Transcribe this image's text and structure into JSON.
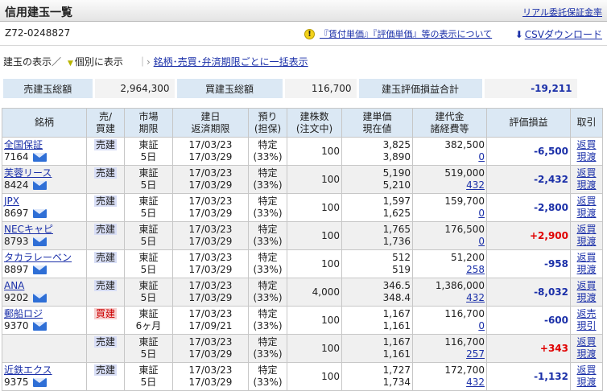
{
  "header": {
    "title": "信用建玉一覧",
    "right_link": "リアル委託保証金率"
  },
  "account": {
    "id": "Z72-0248827"
  },
  "hint": {
    "text": "『賃付単価』『評価単価』等の表示について"
  },
  "csv": {
    "label": "CSVダウンロード"
  },
  "view": {
    "item1": "建玉の表示／",
    "item2": "個別に表示",
    "sep": "｜",
    "item3": "銘柄･売買･弁済期限ごとに一括表示"
  },
  "summary": {
    "sell_label": "売建玉総額",
    "sell_value": "2,964,300",
    "buy_label": "買建玉総額",
    "buy_value": "116,700",
    "pl_label": "建玉評価損益合計",
    "pl_value": "-19,211"
  },
  "columns": {
    "name": "銘柄",
    "side_1": "売/",
    "side_2": "買建",
    "market_1": "市場",
    "market_2": "期限",
    "date_1": "建日",
    "date_2": "返済期限",
    "deposit_1": "預り",
    "deposit_2": "(担保)",
    "qty_1": "建株数",
    "qty_2": "(注文中)",
    "price_1": "建単価",
    "price_2": "現在値",
    "cost_1": "建代金",
    "cost_2": "諸経費等",
    "pl": "評価損益",
    "action": "取引"
  },
  "rows": [
    {
      "name": "全国保証",
      "code": "7164",
      "side": "売建",
      "market": "東証",
      "term": "5日",
      "open_date": "17/03/23",
      "due_date": "17/03/29",
      "deposit_1": "特定",
      "deposit_2": "(33%)",
      "qty": "100",
      "open_price": "3,825",
      "cur_price": "3,890",
      "cost": "382,500",
      "fees": "0",
      "pl": "-6,500",
      "action_1": "返買",
      "action_2": "現渡"
    },
    {
      "name": "芙蓉リース",
      "code": "8424",
      "side": "売建",
      "market": "東証",
      "term": "5日",
      "open_date": "17/03/23",
      "due_date": "17/03/29",
      "deposit_1": "特定",
      "deposit_2": "(33%)",
      "qty": "100",
      "open_price": "5,190",
      "cur_price": "5,210",
      "cost": "519,000",
      "fees": "432",
      "pl": "-2,432",
      "action_1": "返買",
      "action_2": "現渡"
    },
    {
      "name": "JPX",
      "code": "8697",
      "side": "売建",
      "market": "東証",
      "term": "5日",
      "open_date": "17/03/23",
      "due_date": "17/03/29",
      "deposit_1": "特定",
      "deposit_2": "(33%)",
      "qty": "100",
      "open_price": "1,597",
      "cur_price": "1,625",
      "cost": "159,700",
      "fees": "0",
      "pl": "-2,800",
      "action_1": "返買",
      "action_2": "現渡"
    },
    {
      "name": "NECキャピ",
      "code": "8793",
      "side": "売建",
      "market": "東証",
      "term": "5日",
      "open_date": "17/03/23",
      "due_date": "17/03/29",
      "deposit_1": "特定",
      "deposit_2": "(33%)",
      "qty": "100",
      "open_price": "1,765",
      "cur_price": "1,736",
      "cost": "176,500",
      "fees": "0",
      "pl": "+2,900",
      "action_1": "返買",
      "action_2": "現渡"
    },
    {
      "name": "タカラレーベン",
      "code": "8897",
      "side": "売建",
      "market": "東証",
      "term": "5日",
      "open_date": "17/03/23",
      "due_date": "17/03/29",
      "deposit_1": "特定",
      "deposit_2": "(33%)",
      "qty": "100",
      "open_price": "512",
      "cur_price": "519",
      "cost": "51,200",
      "fees": "258",
      "pl": "-958",
      "action_1": "返買",
      "action_2": "現渡"
    },
    {
      "name": "ANA",
      "code": "9202",
      "side": "売建",
      "market": "東証",
      "term": "5日",
      "open_date": "17/03/23",
      "due_date": "17/03/29",
      "deposit_1": "特定",
      "deposit_2": "(33%)",
      "qty": "4,000",
      "open_price": "346.5",
      "cur_price": "348.4",
      "cost": "1,386,000",
      "fees": "432",
      "pl": "-8,032",
      "action_1": "返買",
      "action_2": "現渡"
    },
    {
      "name": "郵船ロジ",
      "code": "9370",
      "side": "買建",
      "market": "東証",
      "term": "6ヶ月",
      "open_date": "17/03/23",
      "due_date": "17/09/21",
      "deposit_1": "特定",
      "deposit_2": "(33%)",
      "qty": "100",
      "open_price": "1,167",
      "cur_price": "1,161",
      "cost": "116,700",
      "fees": "0",
      "pl": "-600",
      "action_1": "返売",
      "action_2": "現引"
    },
    {
      "name": "",
      "code": "",
      "side": "売建",
      "market": "東証",
      "term": "5日",
      "open_date": "17/03/23",
      "due_date": "17/03/29",
      "deposit_1": "特定",
      "deposit_2": "(33%)",
      "qty": "100",
      "open_price": "1,167",
      "cur_price": "1,161",
      "cost": "116,700",
      "fees": "257",
      "pl": "+343",
      "action_1": "返買",
      "action_2": "現渡"
    },
    {
      "name": "近鉄エクス",
      "code": "9375",
      "side": "売建",
      "market": "東証",
      "term": "5日",
      "open_date": "17/03/23",
      "due_date": "17/03/29",
      "deposit_1": "特定",
      "deposit_2": "(33%)",
      "qty": "100",
      "open_price": "1,727",
      "cur_price": "1,734",
      "cost": "172,700",
      "fees": "432",
      "pl": "-1,132",
      "action_1": "返買",
      "action_2": "現渡"
    }
  ]
}
